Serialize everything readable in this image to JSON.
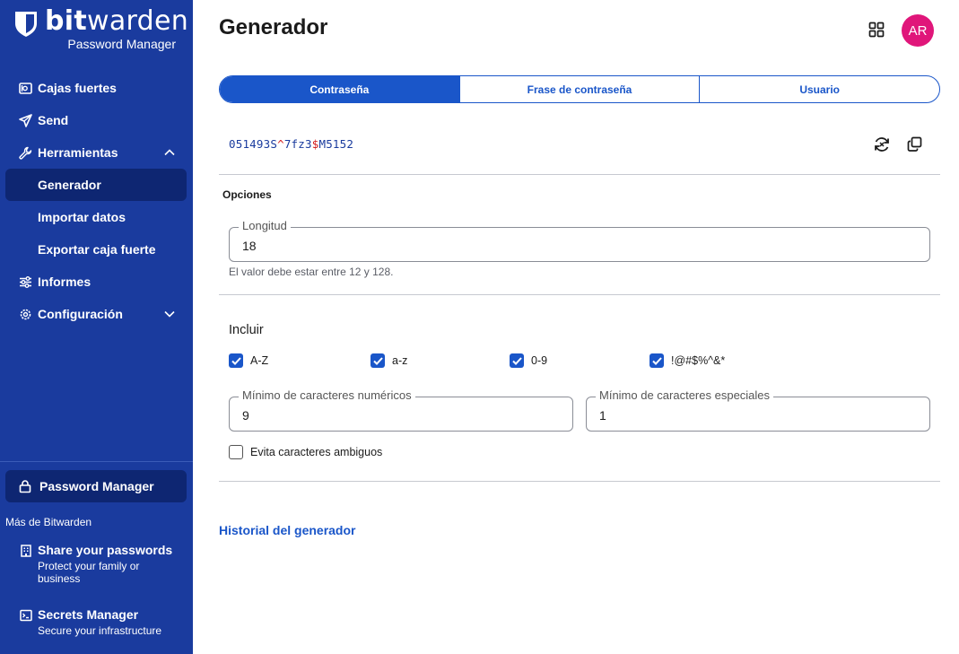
{
  "brand": {
    "name_bold": "bit",
    "name_regular": "warden",
    "subtitle": "Password Manager"
  },
  "sidebar": {
    "items": [
      {
        "label": "Cajas fuertes",
        "icon": "vault-icon"
      },
      {
        "label": "Send",
        "icon": "send-icon"
      },
      {
        "label": "Herramientas",
        "icon": "wrench-icon",
        "expanded": true
      },
      {
        "label": "Generador",
        "active": true
      },
      {
        "label": "Importar datos"
      },
      {
        "label": "Exportar caja fuerte"
      },
      {
        "label": "Informes",
        "icon": "sliders-icon"
      },
      {
        "label": "Configuración",
        "icon": "gear-icon",
        "expanded": false
      }
    ],
    "product_switcher": {
      "label": "Password Manager",
      "icon": "lock-icon"
    },
    "more_label": "Más de Bitwarden",
    "promos": [
      {
        "title": "Share your passwords",
        "desc": "Protect your family or business",
        "icon": "building-icon"
      },
      {
        "title": "Secrets Manager",
        "desc": "Secure your infrastructure",
        "icon": "terminal-icon"
      }
    ]
  },
  "header": {
    "title": "Generador",
    "avatar_initials": "AR",
    "avatar_color": "#e0167a"
  },
  "tabs": [
    {
      "label": "Contraseña",
      "active": true
    },
    {
      "label": "Frase de contraseña",
      "active": false
    },
    {
      "label": "Usuario",
      "active": false
    }
  ],
  "generated": {
    "parts": {
      "a": "051493S",
      "b": "^",
      "c": "7fz3",
      "d": "$",
      "e": "M5152"
    },
    "full": "051493S^7fz3$M5152"
  },
  "options": {
    "title": "Opciones",
    "length_label": "Longitud",
    "length_value": "18",
    "length_hint": "El valor debe estar entre 12 y 128.",
    "include_label": "Incluir",
    "checkboxes": [
      {
        "label": "A-Z",
        "checked": true
      },
      {
        "label": "a-z",
        "checked": true
      },
      {
        "label": "0-9",
        "checked": true
      },
      {
        "label": "!@#$%^&*",
        "checked": true
      }
    ],
    "min_numeric_label": "Mínimo de caracteres numéricos",
    "min_numeric_value": "9",
    "min_special_label": "Mínimo de caracteres especiales",
    "min_special_value": "1",
    "avoid_ambiguous_label": "Evita caracteres ambiguos",
    "avoid_ambiguous_checked": false
  },
  "history_link": "Historial del generador",
  "colors": {
    "sidebar": "#1a3b9e",
    "sidebar_active": "#0e2672",
    "accent": "#1a56c9",
    "special_char": "#d31a1a"
  }
}
